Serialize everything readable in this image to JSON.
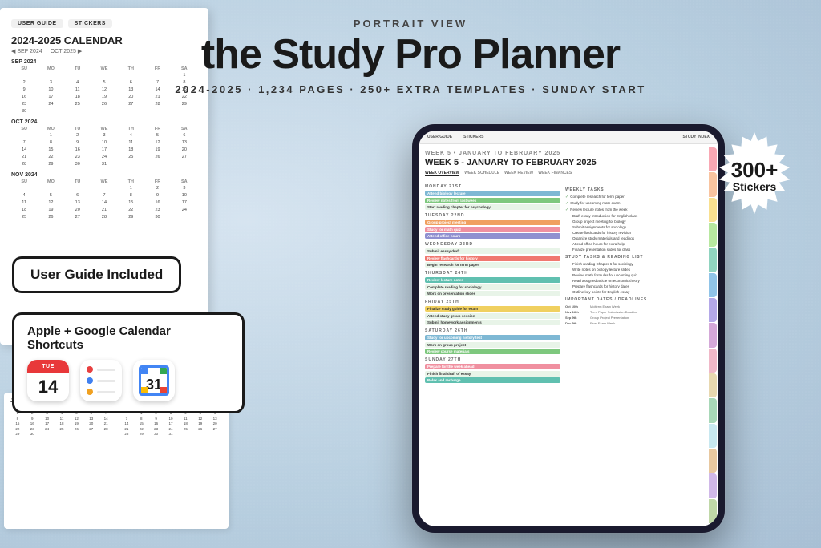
{
  "header": {
    "portrait_label": "PORTRAIT VIEW",
    "main_title": "the Study Pro Planner",
    "subtitle": "2024-2025  ·  1,234 PAGES  ·  250+ EXTRA TEMPLATES  ·  SUNDAY START"
  },
  "stickers_badge": {
    "number": "300+",
    "label": "Stickers"
  },
  "badges": {
    "user_guide": "User Guide Included",
    "apple_google": "Apple + Google Calendar Shortcuts"
  },
  "app_icons": {
    "calendar_day": "TUE",
    "calendar_date": "14",
    "google_cal_date": "31"
  },
  "planner": {
    "week_label": "WEEK 5 • JANUARY TO FEBRUARY 2025",
    "tabs": [
      "WEEK OVERVIEW",
      "WEEK SCHEDULE",
      "WEEK REVIEW",
      "WEEK FINANCES"
    ],
    "nav_tabs": [
      "USER GUIDE",
      "STICKERS",
      "STUDY INDEX"
    ],
    "monday": {
      "label": "MONDAY 21",
      "tasks": [
        "Attend biology lecture",
        "Review notes from last week",
        "Start reading chapter for psychology"
      ]
    },
    "tuesday": {
      "label": "TUESDAY 22",
      "tasks": [
        "Group project meeting",
        "Study for math quiz",
        "Attend office hours"
      ]
    },
    "wednesday": {
      "label": "WEDNESDAY 23",
      "tasks": [
        "Submit essay draft",
        "Review flashcards for history",
        "Begin research for term paper"
      ]
    },
    "thursday": {
      "label": "THURSDAY 24",
      "tasks": [
        "Review lecture notes",
        "Complete reading for sociology",
        "Work on presentation slides"
      ]
    },
    "friday": {
      "label": "FRIDAY 25",
      "tasks": [
        "Finalize study guide for exam",
        "Attend study group session",
        "Submit homework assignments"
      ]
    },
    "saturday": {
      "label": "SATURDAY 26",
      "tasks": [
        "Study for upcoming history test",
        "Work on group project",
        "Review course materials"
      ]
    },
    "sunday": {
      "label": "SUNDAY 27",
      "tasks": [
        "Prepare for the week ahead",
        "Finish final draft of essay",
        "Relax and recharge"
      ]
    },
    "weekly_tasks_title": "WEEKLY TASKS",
    "weekly_tasks": [
      "Complete research for term paper",
      "Study for upcoming math exam",
      "Review lecture notes from the week",
      "Draft essay introduction for English class",
      "Group project meeting for biology",
      "Submit assignments for sociology",
      "Create flashcards for history revision",
      "Organize study materials and readings",
      "Attend office hours for extra help",
      "Finalize presentation slides for class"
    ],
    "study_tasks_title": "STUDY TASKS & READING LIST",
    "study_tasks": [
      "Finish reading Chapter 6 for sociology",
      "Write notes on biology lecture slides",
      "Review math formulas for upcoming quiz",
      "Read assigned article on economic theory",
      "Prepare flashcards for history dates",
      "Outline key points for English essay"
    ],
    "important_dates_title": "IMPORTANT DATES / DEADLINES",
    "important_dates": [
      {
        "date": "Oct 10th",
        "desc": "Midterm Exam Week"
      },
      {
        "date": "Nov 16th",
        "desc": "Term Paper Submission Deadline"
      },
      {
        "date": "Sep 9th",
        "desc": "Group Project Presentation"
      },
      {
        "date": "Dec 5th",
        "desc": "Final Exam Week"
      }
    ]
  },
  "calendar_page": {
    "title": "2024-2025 CALENDAR",
    "tab1": "USER GUIDE",
    "tab2": "STICKERS"
  },
  "colors": {
    "background": "#c8d8e8",
    "task_blue": "#7eb8d4",
    "task_green": "#7ec87e",
    "task_orange": "#f0a060",
    "task_pink": "#f090a0",
    "tab_colors": [
      "#f9a8b4",
      "#f9c4a0",
      "#f9e090",
      "#b8e8a0",
      "#90d4c0",
      "#90c4e8",
      "#b4a8e8",
      "#d4a8d8",
      "#f0b8c8",
      "#e8d8b0",
      "#a8d8b8",
      "#c8e8f0",
      "#e8c8a0",
      "#d0b8e8",
      "#c0d8a8"
    ]
  }
}
